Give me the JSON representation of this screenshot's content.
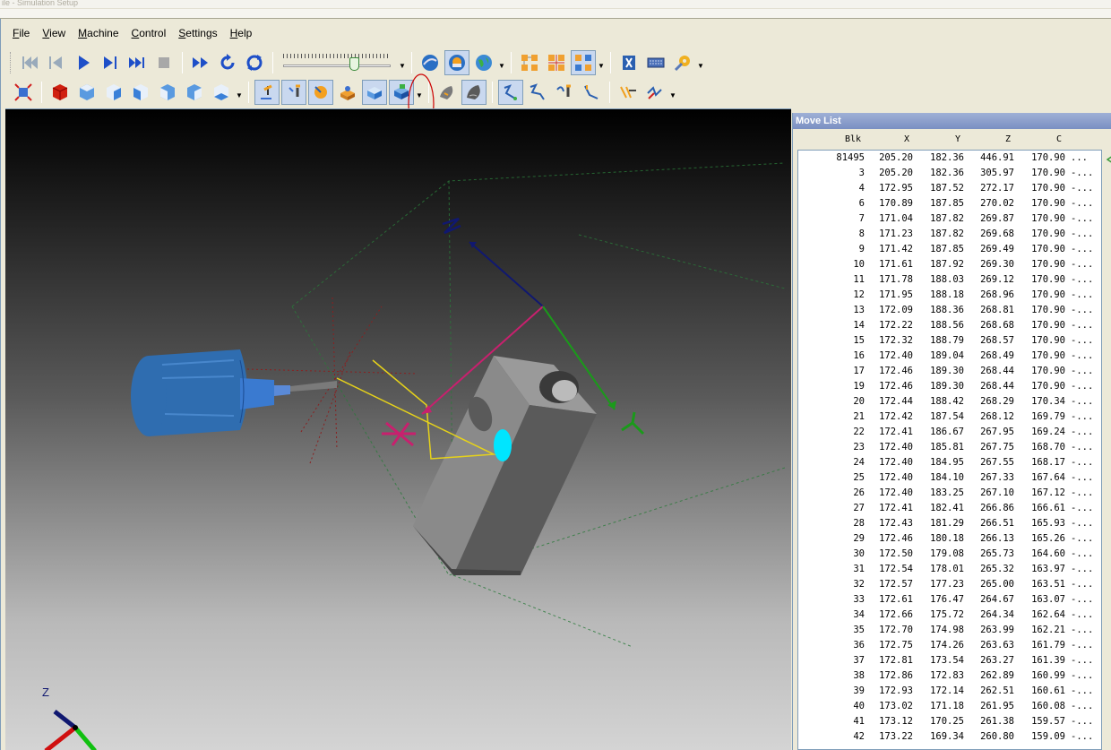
{
  "window": {
    "title": "ile - Simulation Setup"
  },
  "menu": {
    "items": [
      {
        "label": "File",
        "underline": "F",
        "rest": "ile"
      },
      {
        "label": "View",
        "underline": "V",
        "rest": "iew"
      },
      {
        "label": "Machine",
        "underline": "M",
        "rest": "achine"
      },
      {
        "label": "Control",
        "underline": "C",
        "rest": "ontrol"
      },
      {
        "label": "Settings",
        "underline": "S",
        "rest": "ettings"
      },
      {
        "label": "Help",
        "underline": "H",
        "rest": "elp"
      }
    ]
  },
  "toolbar": {
    "speed_slider_value": 0.66,
    "drop_arrow": "▼"
  },
  "viewport": {
    "axis_labels": {
      "z_corner": "Z"
    },
    "colors": {
      "part": "#6f6f6f",
      "tool_body": "#2f6db0",
      "hole_highlight": "#00e5ff",
      "toolpath": "#e6d21a",
      "axis_x": "#c8206e",
      "axis_y": "#1a9a1a",
      "axis_z": "#101870",
      "annotation_circle": "#cc0000"
    }
  },
  "move_list": {
    "title": "Move List",
    "columns": [
      "Blk",
      "X",
      "Y",
      "Z",
      "C"
    ],
    "rows": [
      [
        "81495",
        "205.20",
        "182.36",
        "446.91",
        "170.90",
        "..."
      ],
      [
        "3",
        "205.20",
        "182.36",
        "305.97",
        "170.90",
        "-..."
      ],
      [
        "4",
        "172.95",
        "187.52",
        "272.17",
        "170.90",
        "-..."
      ],
      [
        "6",
        "170.89",
        "187.85",
        "270.02",
        "170.90",
        "-..."
      ],
      [
        "7",
        "171.04",
        "187.82",
        "269.87",
        "170.90",
        "-..."
      ],
      [
        "8",
        "171.23",
        "187.82",
        "269.68",
        "170.90",
        "-..."
      ],
      [
        "9",
        "171.42",
        "187.85",
        "269.49",
        "170.90",
        "-..."
      ],
      [
        "10",
        "171.61",
        "187.92",
        "269.30",
        "170.90",
        "-..."
      ],
      [
        "11",
        "171.78",
        "188.03",
        "269.12",
        "170.90",
        "-..."
      ],
      [
        "12",
        "171.95",
        "188.18",
        "268.96",
        "170.90",
        "-..."
      ],
      [
        "13",
        "172.09",
        "188.36",
        "268.81",
        "170.90",
        "-..."
      ],
      [
        "14",
        "172.22",
        "188.56",
        "268.68",
        "170.90",
        "-..."
      ],
      [
        "15",
        "172.32",
        "188.79",
        "268.57",
        "170.90",
        "-..."
      ],
      [
        "16",
        "172.40",
        "189.04",
        "268.49",
        "170.90",
        "-..."
      ],
      [
        "17",
        "172.46",
        "189.30",
        "268.44",
        "170.90",
        "-..."
      ],
      [
        "19",
        "172.46",
        "189.30",
        "268.44",
        "170.90",
        "-..."
      ],
      [
        "20",
        "172.44",
        "188.42",
        "268.29",
        "170.34",
        "-..."
      ],
      [
        "21",
        "172.42",
        "187.54",
        "268.12",
        "169.79",
        "-..."
      ],
      [
        "22",
        "172.41",
        "186.67",
        "267.95",
        "169.24",
        "-..."
      ],
      [
        "23",
        "172.40",
        "185.81",
        "267.75",
        "168.70",
        "-..."
      ],
      [
        "24",
        "172.40",
        "184.95",
        "267.55",
        "168.17",
        "-..."
      ],
      [
        "25",
        "172.40",
        "184.10",
        "267.33",
        "167.64",
        "-..."
      ],
      [
        "26",
        "172.40",
        "183.25",
        "267.10",
        "167.12",
        "-..."
      ],
      [
        "27",
        "172.41",
        "182.41",
        "266.86",
        "166.61",
        "-..."
      ],
      [
        "28",
        "172.43",
        "181.29",
        "266.51",
        "165.93",
        "-..."
      ],
      [
        "29",
        "172.46",
        "180.18",
        "266.13",
        "165.26",
        "-..."
      ],
      [
        "30",
        "172.50",
        "179.08",
        "265.73",
        "164.60",
        "-..."
      ],
      [
        "31",
        "172.54",
        "178.01",
        "265.32",
        "163.97",
        "-..."
      ],
      [
        "32",
        "172.57",
        "177.23",
        "265.00",
        "163.51",
        "-..."
      ],
      [
        "33",
        "172.61",
        "176.47",
        "264.67",
        "163.07",
        "-..."
      ],
      [
        "34",
        "172.66",
        "175.72",
        "264.34",
        "162.64",
        "-..."
      ],
      [
        "35",
        "172.70",
        "174.98",
        "263.99",
        "162.21",
        "-..."
      ],
      [
        "36",
        "172.75",
        "174.26",
        "263.63",
        "161.79",
        "-..."
      ],
      [
        "37",
        "172.81",
        "173.54",
        "263.27",
        "161.39",
        "-..."
      ],
      [
        "38",
        "172.86",
        "172.83",
        "262.89",
        "160.99",
        "-..."
      ],
      [
        "39",
        "172.93",
        "172.14",
        "262.51",
        "160.61",
        "-..."
      ],
      [
        "40",
        "173.02",
        "171.18",
        "261.95",
        "160.08",
        "-..."
      ],
      [
        "41",
        "173.12",
        "170.25",
        "261.38",
        "159.57",
        "-..."
      ],
      [
        "42",
        "173.22",
        "169.34",
        "260.80",
        "159.09",
        "-..."
      ]
    ]
  }
}
